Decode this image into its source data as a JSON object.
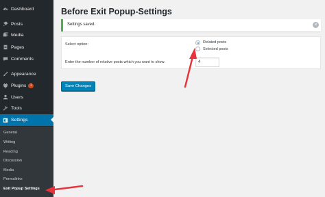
{
  "page": {
    "title": "Before Exit Popup-Settings"
  },
  "sidebar": {
    "items": [
      {
        "label": "Dashboard",
        "icon": "dashboard-icon"
      },
      {
        "label": "Posts",
        "icon": "pin-icon"
      },
      {
        "label": "Media",
        "icon": "media-icon"
      },
      {
        "label": "Pages",
        "icon": "pages-icon"
      },
      {
        "label": "Comments",
        "icon": "comments-icon"
      },
      {
        "label": "Appearance",
        "icon": "paintbrush-icon"
      },
      {
        "label": "Plugins",
        "icon": "plugins-icon",
        "badge": "1"
      },
      {
        "label": "Users",
        "icon": "users-icon"
      },
      {
        "label": "Tools",
        "icon": "wrench-icon"
      },
      {
        "label": "Settings",
        "icon": "settings-icon",
        "active": true
      }
    ],
    "submenu": [
      {
        "label": "General"
      },
      {
        "label": "Writing"
      },
      {
        "label": "Reading"
      },
      {
        "label": "Discussion"
      },
      {
        "label": "Media"
      },
      {
        "label": "Permalinks"
      },
      {
        "label": "Exit Popup Settings",
        "current": true
      }
    ]
  },
  "notice": {
    "text": "Settings saved.",
    "type": "success"
  },
  "form": {
    "select_label": "Select option:",
    "options": [
      {
        "label": "Related posts",
        "checked": true
      },
      {
        "label": "Selected posts",
        "checked": false
      }
    ],
    "count_label": "Enter the number of relative posts which you want to show.",
    "count_value": "4"
  },
  "buttons": {
    "save_label": "Save Changes"
  },
  "colors": {
    "admin_bar": "#23282d",
    "active": "#0073aa",
    "notice_border": "#46b450",
    "button": "#0085ba",
    "annotation_arrow": "#e8323c"
  }
}
